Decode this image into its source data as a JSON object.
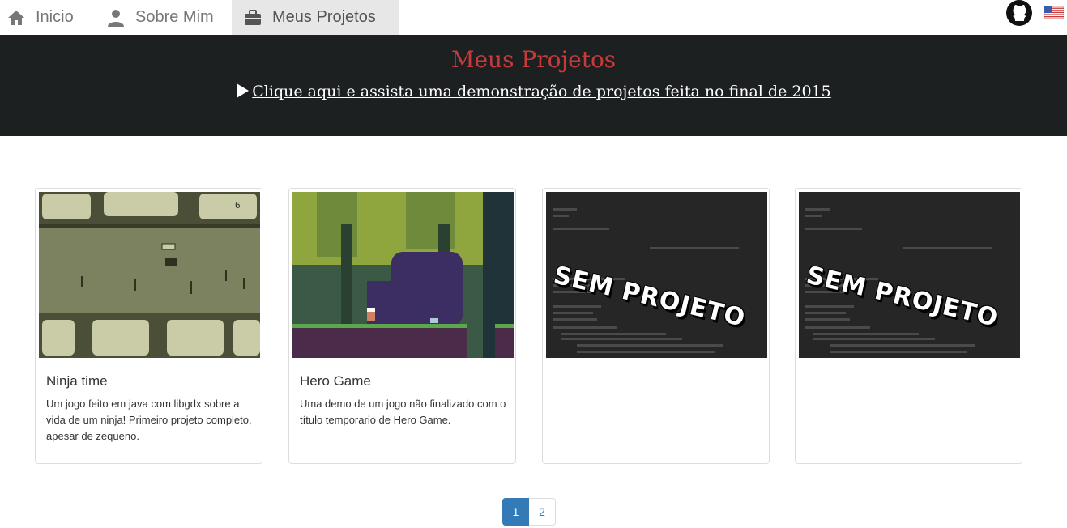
{
  "nav": {
    "items": [
      {
        "label": "Inicio",
        "icon": "home-icon"
      },
      {
        "label": "Sobre Mim",
        "icon": "user-icon"
      },
      {
        "label": "Meus Projetos",
        "icon": "briefcase-icon",
        "active": true
      }
    ],
    "right_icons": [
      "github-icon",
      "us-flag-icon"
    ]
  },
  "header": {
    "title": "Meus Projetos",
    "demo_link": "Clique aqui e assista uma demonstração de projetos feita no final de 2015"
  },
  "projects": [
    {
      "title": "Ninja time",
      "description": "Um jogo feito em java com libgdx sobre a vida de um ninja! Primeiro projeto completo, apesar de zequeno.",
      "image": "ninja-time-screenshot"
    },
    {
      "title": "Hero Game",
      "description": "Uma demo de um jogo não finalizado com o título temporario de Hero Game.",
      "image": "hero-game-screenshot"
    },
    {
      "title": "",
      "description": "",
      "image": "sem-projeto-placeholder",
      "placeholder_text": "SEM PROJETO"
    },
    {
      "title": "",
      "description": "",
      "image": "sem-projeto-placeholder",
      "placeholder_text": "SEM PROJETO"
    }
  ],
  "pagination": {
    "pages": [
      "1",
      "2"
    ],
    "current": "1"
  },
  "colors": {
    "header_bg": "#1d2021",
    "title_red": "#c8393a",
    "active_page": "#337ab7"
  }
}
